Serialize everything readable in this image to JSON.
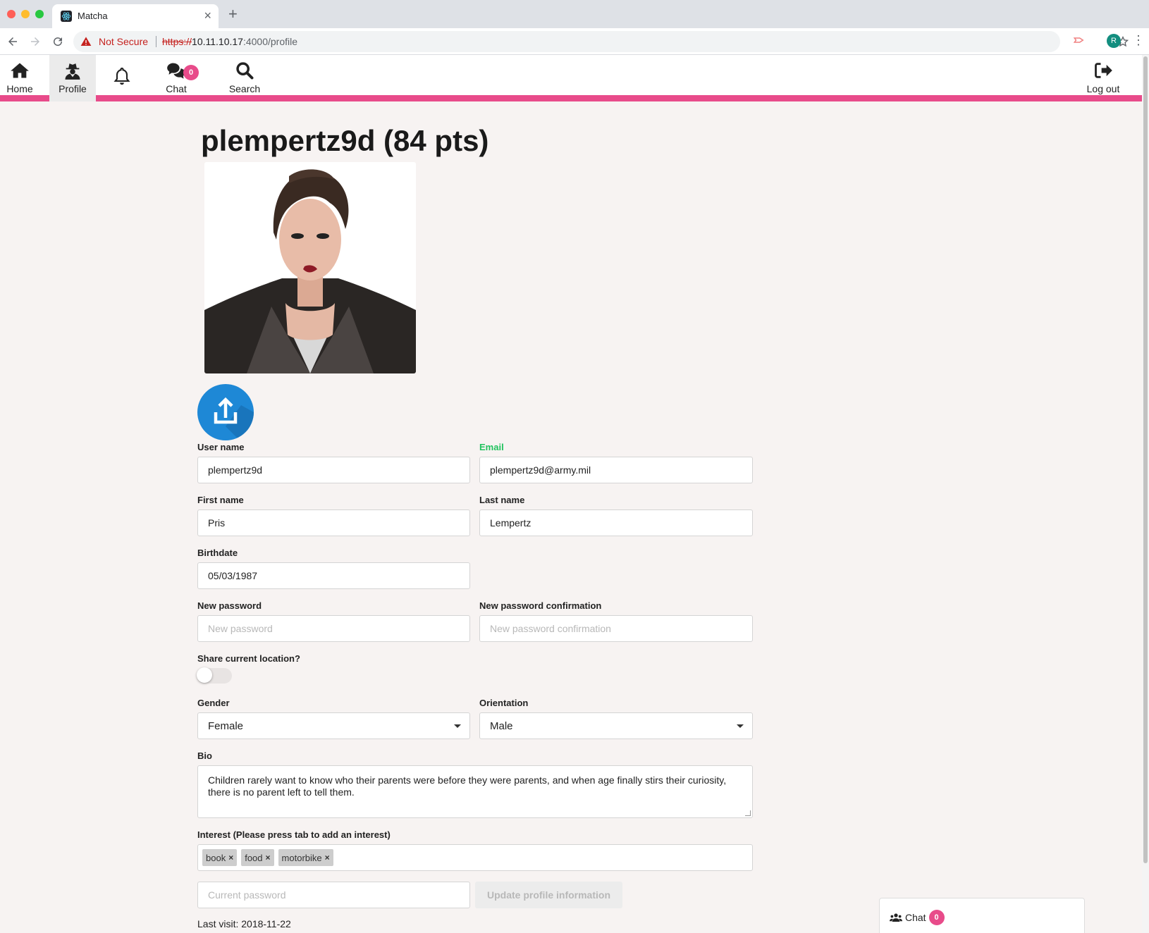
{
  "browser": {
    "tab_title": "Matcha",
    "security_label": "Not Secure",
    "url_protocol": "https://",
    "url_host": "10.11.10.17",
    "url_rest": ":4000/profile",
    "profile_initial": "R"
  },
  "nav": {
    "home": "Home",
    "profile": "Profile",
    "chat": "Chat",
    "chat_count": "0",
    "search": "Search",
    "logout": "Log out"
  },
  "profile": {
    "title": "plempertz9d (84 pts)",
    "labels": {
      "username": "User name",
      "email": "Email",
      "first_name": "First name",
      "last_name": "Last name",
      "birthdate": "Birthdate",
      "new_password": "New password",
      "new_password_confirm": "New password confirmation",
      "share_location": "Share current location?",
      "gender": "Gender",
      "orientation": "Orientation",
      "bio": "Bio",
      "interest": "Interest (Please press tab to add an interest)"
    },
    "values": {
      "username": "plempertz9d",
      "email": "plempertz9d@army.mil",
      "first_name": "Pris",
      "last_name": "Lempertz",
      "birthdate": "05/03/1987",
      "gender": "Female",
      "orientation": "Male",
      "bio": "Children rarely want to know who their parents were before they were parents, and when age finally stirs their curiosity, there is no parent left to tell them.",
      "share_location": false
    },
    "placeholders": {
      "new_password": "New password",
      "new_password_confirm": "New password confirmation",
      "current_password": "Current password"
    },
    "tags": [
      "book",
      "food",
      "motorbike"
    ],
    "update_button": "Update profile information",
    "last_visit": "Last visit: 2018-11-22"
  },
  "chat_widget": {
    "label": "Chat",
    "count": "0"
  },
  "colors": {
    "accent_pink": "#e84b8a",
    "upload_blue": "#1e88d6",
    "email_label_green": "#21c25e"
  }
}
